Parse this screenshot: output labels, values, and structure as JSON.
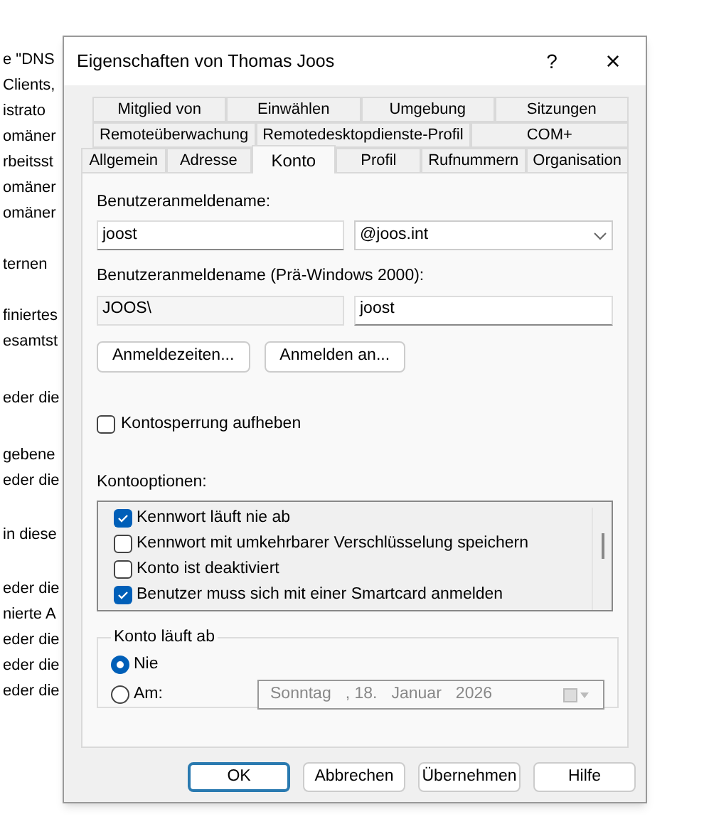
{
  "background_lines": [
    "e \"DNS",
    "Clients,",
    "istrato",
    "omäner",
    "rbeitsst",
    "omäner",
    "omäner",
    "ternen",
    "finiertes",
    "esamtst",
    "eder die",
    "gebene",
    "eder die",
    "in diese",
    "eder die",
    "nierte A",
    "eder die",
    "eder die",
    "eder die"
  ],
  "window": {
    "title": "Eigenschaften von Thomas Joos",
    "help": "?",
    "close": "×"
  },
  "tab_rows": [
    [
      {
        "label": "Mitglied von",
        "selected": false
      },
      {
        "label": "Einwählen",
        "selected": false
      },
      {
        "label": "Umgebung",
        "selected": false
      },
      {
        "label": "Sitzungen",
        "selected": false
      }
    ],
    [
      {
        "label": "Remoteüberwachung",
        "selected": false
      },
      {
        "label": "Remotedesktopdienste-Profil",
        "selected": false
      },
      {
        "label": "COM+",
        "selected": false
      }
    ],
    [
      {
        "label": "Allgemein",
        "selected": false
      },
      {
        "label": "Adresse",
        "selected": false
      },
      {
        "label": "Konto",
        "selected": true
      },
      {
        "label": "Profil",
        "selected": false
      },
      {
        "label": "Rufnummern",
        "selected": false
      },
      {
        "label": "Organisation",
        "selected": false
      }
    ]
  ],
  "logon_name": {
    "label": "Benutzeranmeldename:",
    "value": "joost",
    "domain": "@joos.int"
  },
  "pre_windows": {
    "label": "Benutzeranmeldename (Prä-Windows 2000):",
    "domain": "JOOS\\",
    "value": "joost"
  },
  "logon_buttons": [
    "Anmeldezeiten...",
    "Anmelden an..."
  ],
  "unlock": {
    "label": "Kontosperrung aufheben",
    "checked": false
  },
  "options": {
    "label": "Kontooptionen:",
    "items": [
      {
        "label": "Kennwort läuft nie ab",
        "checked": true
      },
      {
        "label": "Kennwort mit umkehrbarer Verschlüsselung speichern",
        "checked": false
      },
      {
        "label": "Konto ist deaktiviert",
        "checked": false
      },
      {
        "label": "Benutzer muss sich mit einer Smartcard anmelden",
        "checked": true
      }
    ]
  },
  "expires": {
    "title": "Konto läuft ab",
    "choices": [
      {
        "label": "Nie",
        "selected": true
      },
      {
        "label": "Am:",
        "selected": false
      }
    ],
    "date": [
      "Sonntag",
      ", 18.",
      "Januar",
      "2026"
    ],
    "date_disabled": true
  },
  "buttons": [
    {
      "label": "OK",
      "default": true
    },
    {
      "label": "Abbrechen",
      "default": false
    },
    {
      "label": "Übernehmen",
      "default": false
    },
    {
      "label": "Hilfe",
      "default": false
    }
  ]
}
